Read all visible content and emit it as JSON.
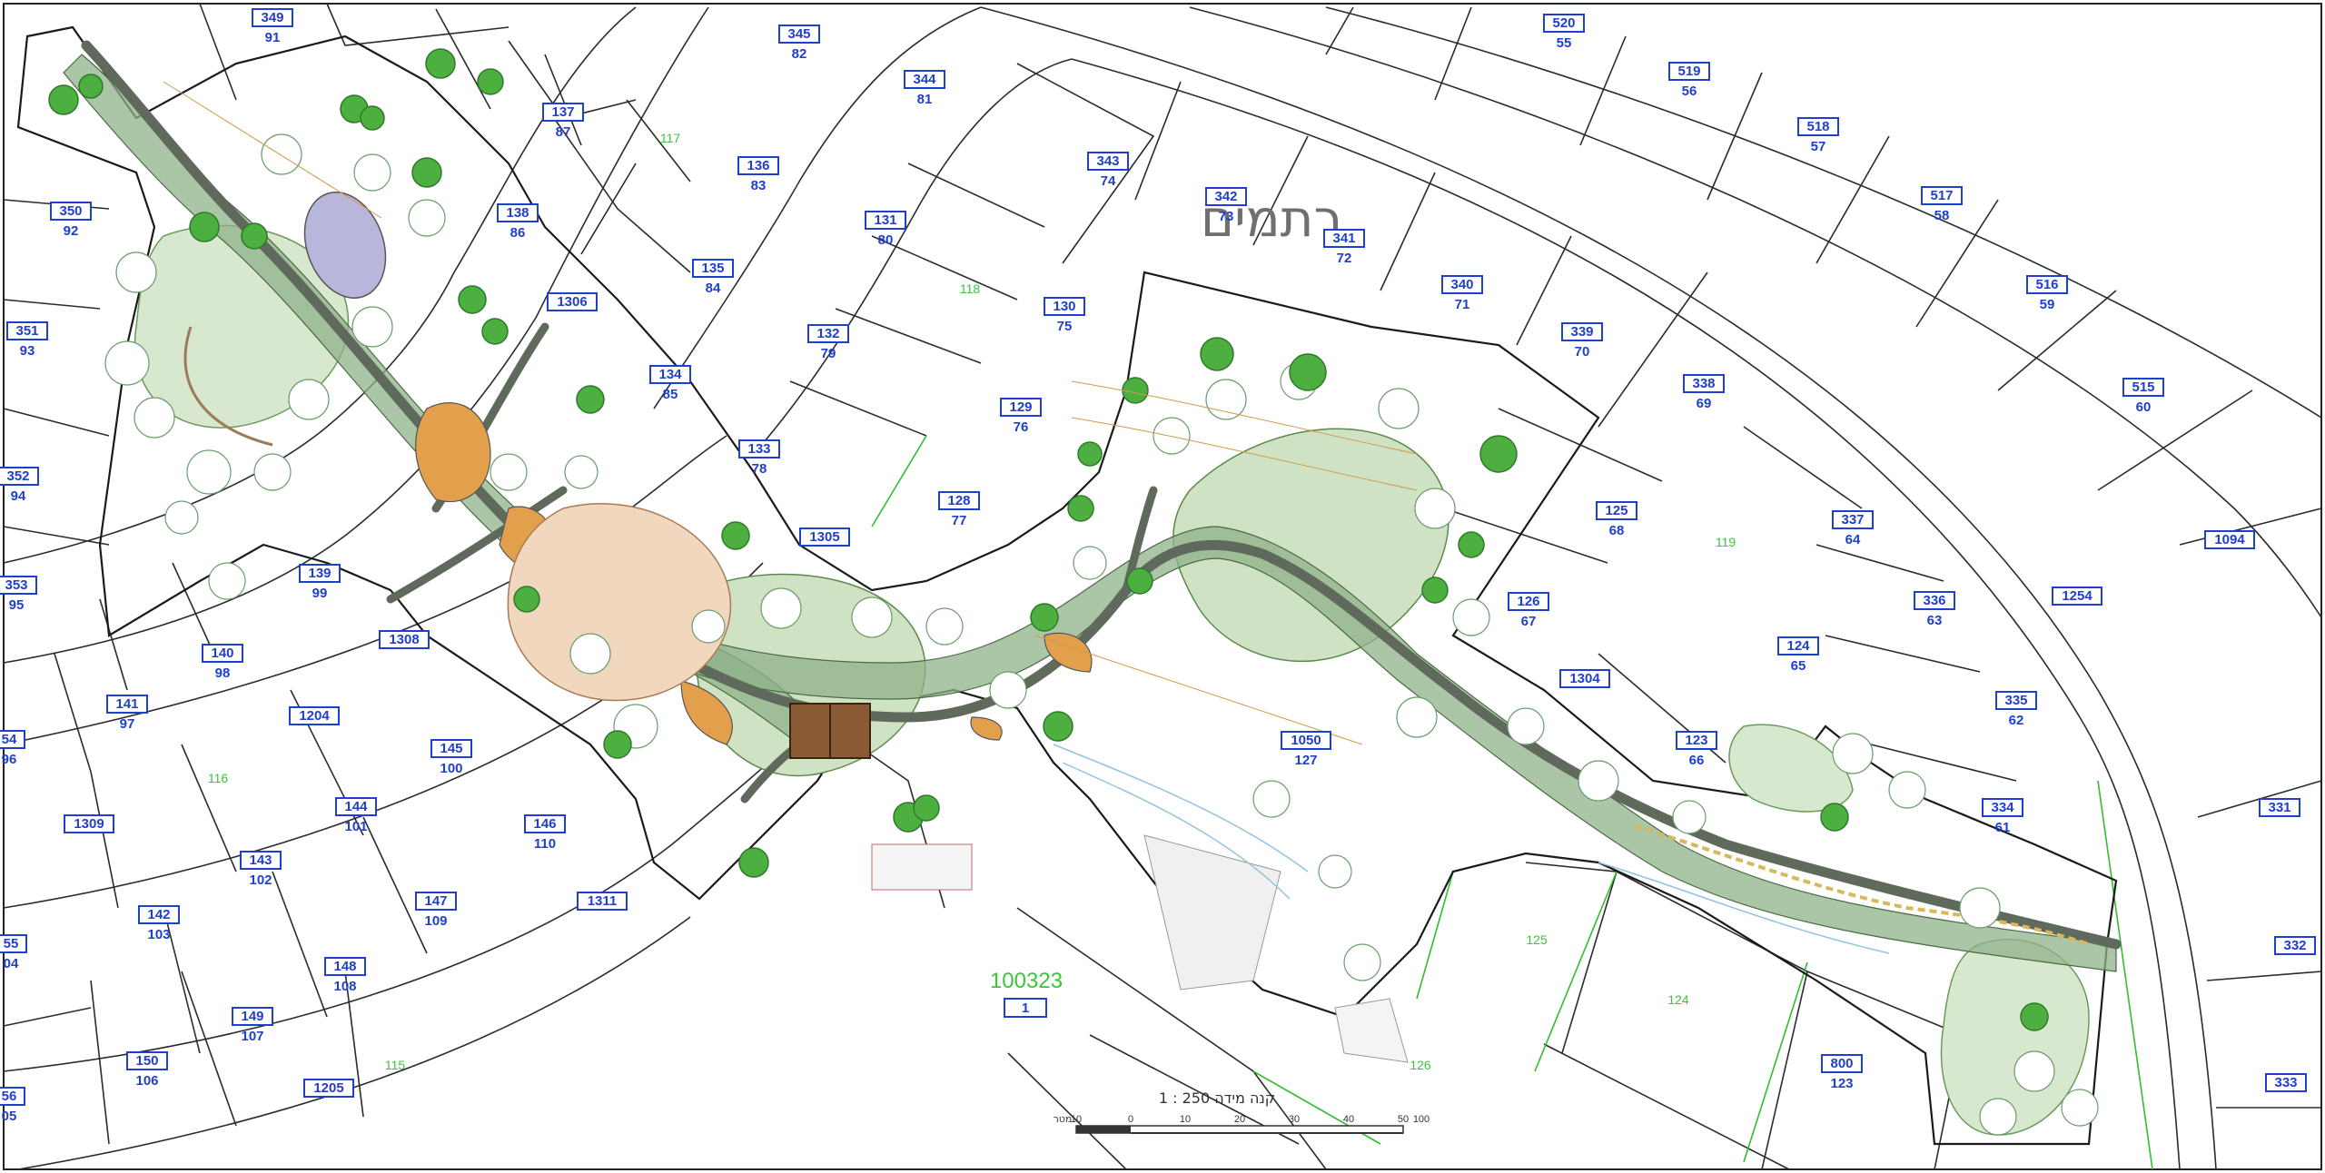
{
  "map": {
    "street_name": "רתמים",
    "main_parcel_number": "100323",
    "main_parcel_box": "1",
    "scale_label": "קנה מידה  250 : 1",
    "scale_ticks": [
      "10",
      "0",
      "10",
      "20",
      "30",
      "40",
      "50",
      "100"
    ],
    "scale_unit": "מטר",
    "colors": {
      "plot_box": "#1f3fd0",
      "plot_sub": "#3cc43c",
      "path": "#5e6e5a",
      "lawn": "#cfe3c4",
      "tree": "#3d9a3d",
      "orange_area": "#e2a04c",
      "pergola": "#8a5a35",
      "pond": "#b9b6dc"
    },
    "lots": [
      {
        "id": "349",
        "sub": "91"
      },
      {
        "id": "345",
        "sub": "82"
      },
      {
        "id": "344",
        "sub": "81"
      },
      {
        "id": "137",
        "sub": "87"
      },
      {
        "id": "136",
        "sub": "83"
      },
      {
        "id": "131",
        "sub": "80"
      },
      {
        "id": "350",
        "sub": "92"
      },
      {
        "id": "138",
        "sub": "86"
      },
      {
        "id": "1306",
        "sub": ""
      },
      {
        "id": "135",
        "sub": "84"
      },
      {
        "id": "132",
        "sub": "79"
      },
      {
        "id": "351",
        "sub": "93"
      },
      {
        "id": "134",
        "sub": "85"
      },
      {
        "id": "133",
        "sub": "78"
      },
      {
        "id": "352",
        "sub": "94"
      },
      {
        "id": "353",
        "sub": "95"
      },
      {
        "id": "139",
        "sub": "99"
      },
      {
        "id": "1308",
        "sub": ""
      },
      {
        "id": "140",
        "sub": "98"
      },
      {
        "id": "141",
        "sub": "97"
      },
      {
        "id": "1204",
        "sub": ""
      },
      {
        "id": "145",
        "sub": "100"
      },
      {
        "id": "54",
        "sub": "96"
      },
      {
        "id": "1309",
        "sub": ""
      },
      {
        "id": "144",
        "sub": "101"
      },
      {
        "id": "146",
        "sub": "110"
      },
      {
        "id": "143",
        "sub": "102"
      },
      {
        "id": "142",
        "sub": "103"
      },
      {
        "id": "147",
        "sub": "109"
      },
      {
        "id": "1311",
        "sub": ""
      },
      {
        "id": "55",
        "sub": "04"
      },
      {
        "id": "148",
        "sub": "108"
      },
      {
        "id": "149",
        "sub": "107"
      },
      {
        "id": "150",
        "sub": "106"
      },
      {
        "id": "1205",
        "sub": ""
      },
      {
        "id": "56",
        "sub": "05"
      },
      {
        "id": "343",
        "sub": "74"
      },
      {
        "id": "342",
        "sub": "73"
      },
      {
        "id": "341",
        "sub": "72"
      },
      {
        "id": "130",
        "sub": "75"
      },
      {
        "id": "340",
        "sub": "71"
      },
      {
        "id": "339",
        "sub": "70"
      },
      {
        "id": "129",
        "sub": "76"
      },
      {
        "id": "338",
        "sub": "69"
      },
      {
        "id": "128",
        "sub": "77"
      },
      {
        "id": "1305",
        "sub": ""
      },
      {
        "id": "125",
        "sub": "68"
      },
      {
        "id": "126",
        "sub": "67"
      },
      {
        "id": "1304",
        "sub": ""
      },
      {
        "id": "1050",
        "sub": "127"
      },
      {
        "id": "123",
        "sub": "66"
      },
      {
        "id": "520",
        "sub": "55"
      },
      {
        "id": "519",
        "sub": "56"
      },
      {
        "id": "518",
        "sub": "57"
      },
      {
        "id": "517",
        "sub": "58"
      },
      {
        "id": "516",
        "sub": "59"
      },
      {
        "id": "515",
        "sub": "60"
      },
      {
        "id": "1094",
        "sub": ""
      },
      {
        "id": "337",
        "sub": "64"
      },
      {
        "id": "1254",
        "sub": ""
      },
      {
        "id": "336",
        "sub": "63"
      },
      {
        "id": "124",
        "sub": "65"
      },
      {
        "id": "335",
        "sub": "62"
      },
      {
        "id": "334",
        "sub": "61"
      },
      {
        "id": "331",
        "sub": ""
      },
      {
        "id": "332",
        "sub": ""
      },
      {
        "id": "333",
        "sub": ""
      },
      {
        "id": "800",
        "sub": "123"
      }
    ],
    "area_numbers": [
      "117",
      "118",
      "116",
      "115",
      "119",
      "125",
      "124",
      "126"
    ]
  }
}
